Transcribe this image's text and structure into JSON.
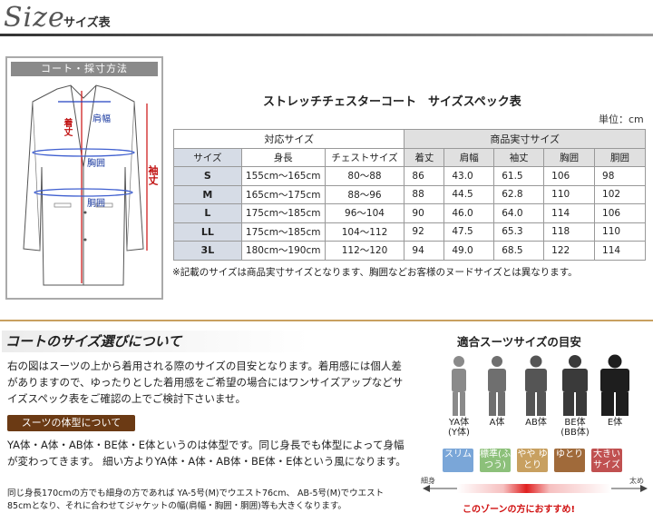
{
  "header": {
    "title": "Size",
    "subtitle": "サイズ表"
  },
  "diagram": {
    "title": "コート・採寸方法",
    "labels": {
      "length": "着丈",
      "shoulder": "肩幅",
      "chest": "胸囲",
      "waist": "胴囲",
      "sleeve": "袖丈"
    }
  },
  "spec": {
    "title": "ストレッチチェスターコート　サイズスペック表",
    "unit": "単位：cm",
    "group1": "対応サイズ",
    "group2": "商品実寸サイズ",
    "columns": [
      "サイズ",
      "身長",
      "チェストサイズ",
      "着丈",
      "肩幅",
      "袖丈",
      "胸囲",
      "胴囲"
    ],
    "rows": [
      [
        "S",
        "155cm〜165cm",
        "80〜88",
        "86",
        "43.0",
        "61.5",
        "106",
        "98"
      ],
      [
        "M",
        "165cm〜175cm",
        "88〜96",
        "88",
        "44.5",
        "62.8",
        "110",
        "102"
      ],
      [
        "L",
        "175cm〜185cm",
        "96〜104",
        "90",
        "46.0",
        "64.0",
        "114",
        "106"
      ],
      [
        "LL",
        "175cm〜185cm",
        "104〜112",
        "92",
        "47.5",
        "65.3",
        "118",
        "110"
      ],
      [
        "3L",
        "180cm〜190cm",
        "112〜120",
        "94",
        "49.0",
        "68.5",
        "122",
        "114"
      ]
    ],
    "note": "※記載のサイズは商品実寸サイズとなります、胸囲などお客様のヌードサイズとは異なります。"
  },
  "about": {
    "title": "コートのサイズ選びについて",
    "para1": "右の図はスーツの上から着用される際のサイズの目安となります。着用感には個人差がありますので、ゆったりとした着用感をご希望の場合にはワンサイズアップなどサイズスペック表をご確認の上でご検討下さいませ。",
    "badge": "スーツの体型について",
    "para2": "YA体・A体・AB体・BE体・E体というのは体型です。同じ身長でも体型によって身幅が変わってきます。 細い方よりYA体・A体・AB体・BE体・E体という風になります。",
    "para3": "同じ身長170cmの方でも細身の方であれば YA-5号(M)でウエスト76cm、 AB-5号(M)でウエスト85cmとなり、それに合わせてジャケットの幅(肩幅・胸囲・胴囲)等も大きくなります。"
  },
  "guide": {
    "title": "適合スーツサイズの目安",
    "figures": [
      {
        "label": "YA体",
        "sub": "(Y体)",
        "color": "#8a8a8a"
      },
      {
        "label": "A体",
        "sub": "",
        "color": "#6f6f6f"
      },
      {
        "label": "AB体",
        "sub": "",
        "color": "#555555"
      },
      {
        "label": "BE体",
        "sub": "(BB体)",
        "color": "#3a3a3a"
      },
      {
        "label": "E体",
        "sub": "",
        "color": "#1e1e1e"
      }
    ],
    "tags": [
      {
        "text": "スリム",
        "color": "#7aa6d8"
      },
      {
        "text": "標準(ふつう)",
        "color": "#8cc07a"
      },
      {
        "text": "やや ゆとり",
        "color": "#c8a060"
      },
      {
        "text": "ゆとり",
        "color": "#a06a3a"
      },
      {
        "text": "大きい サイズ",
        "color": "#c05050"
      }
    ],
    "left_label": "細身",
    "right_label": "太め",
    "zone_label": "このゾーンの方におすすめ!"
  }
}
